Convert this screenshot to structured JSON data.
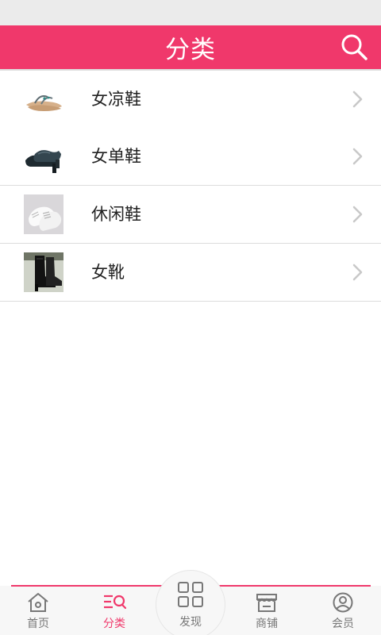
{
  "header": {
    "title": "分类"
  },
  "categories": [
    {
      "label": "女凉鞋",
      "thumb_icon": "sandal-icon"
    },
    {
      "label": "女单鞋",
      "thumb_icon": "shoe-icon"
    },
    {
      "label": "休闲鞋",
      "thumb_icon": "sneaker-icon"
    },
    {
      "label": "女靴",
      "thumb_icon": "boot-icon"
    }
  ],
  "tabbar": {
    "tabs": [
      {
        "label": "首页",
        "icon": "home-icon",
        "active": false
      },
      {
        "label": "分类",
        "icon": "category-icon",
        "active": true
      },
      {
        "label": "发现",
        "icon": "grid-icon",
        "active": false
      },
      {
        "label": "商铺",
        "icon": "store-icon",
        "active": false
      },
      {
        "label": "会员",
        "icon": "user-icon",
        "active": false
      }
    ]
  },
  "colors": {
    "accent": "#f0386b",
    "status_bar": "#ebebeb",
    "tab_inactive": "#777777"
  }
}
